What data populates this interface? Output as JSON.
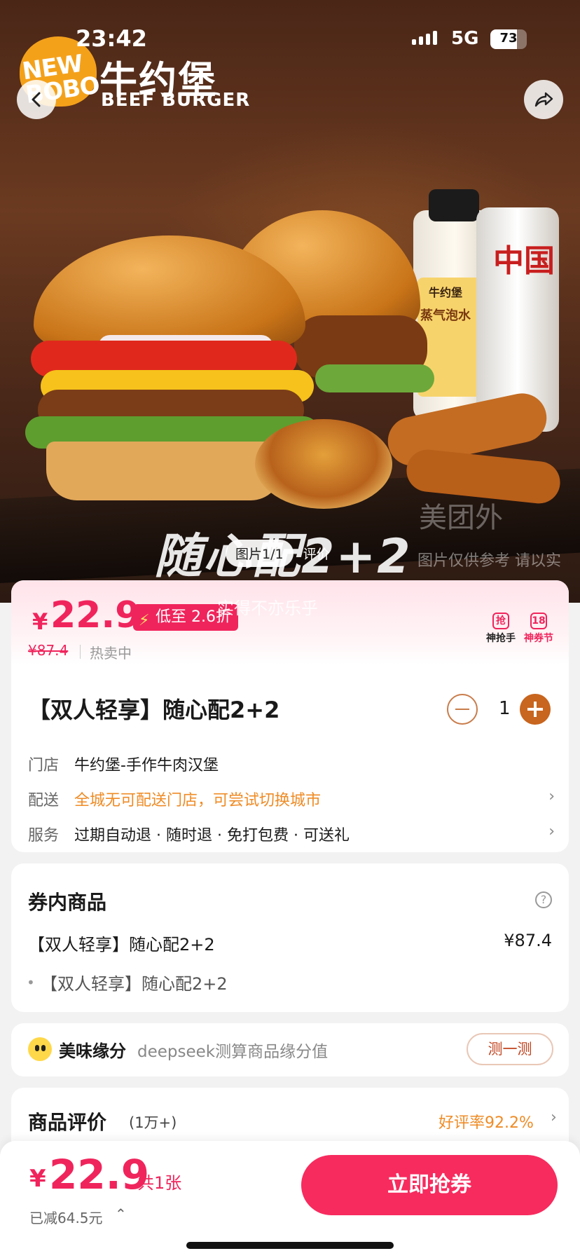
{
  "status_bar": {
    "time": "23:42",
    "network": "5G",
    "battery": "73",
    "battery_level": 0.73
  },
  "hero": {
    "brand_badge_text": "NEW\nBOBO",
    "brand_name_cn": "牛约堡",
    "brand_name_en": "BEEF BURGER",
    "slogan": "随心配2+2",
    "watermark": "美团外",
    "watermark_note": "图片仅供参考 请以实",
    "image_tab_active": "图片1/1",
    "image_tab_other": "评价",
    "bottle_label": "牛约堡",
    "bottle_text": "蒸气泡水",
    "can_text": "中国"
  },
  "price_section": {
    "currency": "¥",
    "price": "22.9",
    "discount_badge": "低至 2.6折",
    "slogan_overlay": "实得不亦乐乎",
    "original_price": "¥87.4",
    "sale_status": "热卖中",
    "promos": [
      {
        "icon": "抢",
        "label": "神抢手"
      },
      {
        "icon": "18",
        "label": "神券节"
      }
    ]
  },
  "product": {
    "title": "【双人轻享】随心配2+2",
    "quantity": "1",
    "store_label": "门店",
    "store_value": "牛约堡-手作牛肉汉堡",
    "delivery_label": "配送",
    "delivery_value": "全城无可配送门店，可尝试切换城市",
    "service_label": "服务",
    "service_value": "过期自动退 · 随时退 · 免打包费 · 可送礼"
  },
  "coupon_items": {
    "title": "券内商品",
    "help": "?",
    "item_name": "【双人轻享】随心配2+2",
    "item_price": "¥87.4",
    "sub_item": "【双人轻享】随心配2+2"
  },
  "match": {
    "title": "美味缘分",
    "desc": "deepseek测算商品缘分值",
    "button": "测一测"
  },
  "reviews": {
    "title": "商品评价",
    "count": "(1万+)",
    "rate": "好评率92.2%"
  },
  "bottom_bar": {
    "currency": "¥",
    "price": "22.9",
    "count": "共1张",
    "saved": "已减64.5元",
    "buy_label": "立即抢券"
  },
  "colors": {
    "accent": "#f0245c",
    "orange": "#ef8b25",
    "brown": "#c8651e"
  }
}
